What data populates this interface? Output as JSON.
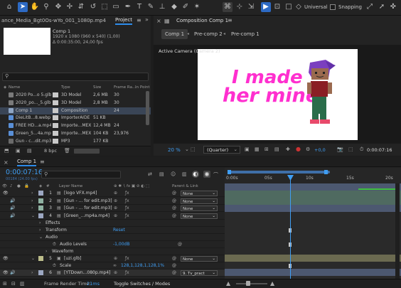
{
  "toolbar": {
    "home_icon": "home-icon",
    "universal_label": "Universal",
    "snapping_label": "Snapping"
  },
  "project": {
    "breadcrumb": "ance_Media_Bgt0Os-wYo_001_1080p.mp4",
    "tab_label": "Project",
    "selected_name": "Comp 1",
    "meta_line1": "1920 x 1080 (960 x 540) (1,00)",
    "meta_line2": "Δ 0:00:35:00, 24,00 fps",
    "search_placeholder": "",
    "columns": {
      "name": "Name",
      "type": "Type",
      "size": "Size",
      "frame_rate": "Frame Ra...",
      "in_point": "In Point"
    },
    "items": [
      {
        "name": "2020 Po...o 5.glb",
        "type": "3D Model",
        "size": "2,6 MB",
        "rate": "30",
        "icon_color": "#7a7a7a",
        "label_color": "#c9c9c9"
      },
      {
        "name": "2020_po..._5.glb",
        "type": "3D Model",
        "size": "2,8 MB",
        "rate": "30",
        "icon_color": "#7a7a7a",
        "label_color": "#c9c9c9"
      },
      {
        "name": "Comp 1",
        "type": "Composition",
        "size": "",
        "rate": "24",
        "icon_color": "#8fa6c4",
        "label_color": "#c9c9c9"
      },
      {
        "name": "DieLitB...8.webp",
        "type": "ImporterAIDE",
        "size": "51 KB",
        "rate": "",
        "icon_color": "#5a8fd6",
        "label_color": "#c9c9c9"
      },
      {
        "name": "FREE HD...a.mp4",
        "type": "Importe...MEX",
        "size": "12,4 MB",
        "rate": "24",
        "icon_color": "#5a8fd6",
        "label_color": "#c9c9c9"
      },
      {
        "name": "Green_5...4a.mp4",
        "type": "Importe...MEX",
        "size": "104 KB",
        "rate": "23,976",
        "icon_color": "#5a8fd6",
        "label_color": "#c9c9c9"
      },
      {
        "name": "Gun - c...dit.mp3",
        "type": "MP3",
        "size": "177 KB",
        "rate": "",
        "icon_color": "#6a6a6a",
        "label_color": "#c9c9c9"
      }
    ],
    "bpc_label": "8 bpc"
  },
  "composition": {
    "panel_title": "Composition Comp 1",
    "tabs": [
      "Comp 1",
      "Pre-comp 2",
      "Pre-comp 1"
    ],
    "camera_label": "Active Camera (Camera 2)",
    "canvas_text_line1": "I made",
    "canvas_text_line2": "her mine",
    "zoom": "20 %",
    "resolution": "(Quarter)",
    "exposure": "+0,0",
    "timecode": "0:00:07:16"
  },
  "timeline": {
    "tab": "Comp 1",
    "timecode": "0:00:07:16",
    "frames_label": "00184 (24.00 fps)",
    "search_placeholder": "",
    "col_layer_name": "Layer Name",
    "col_parent": "Parent & Link",
    "layers": [
      {
        "num": "1",
        "name": "[logo VFX.mp4]",
        "parent": "None",
        "color": "#9ca7c2"
      },
      {
        "num": "2",
        "name": "[Gun - ... for edit.mp3]",
        "parent": "None",
        "color": "#8fb2a2"
      },
      {
        "num": "3",
        "name": "[Gun - ... for edit.mp3]",
        "parent": "None",
        "color": "#8fb2a2"
      },
      {
        "num": "4",
        "name": "[Green_...mp4a.mp4]",
        "parent": "None",
        "color": "#9ca7c2"
      }
    ],
    "props": {
      "effects": "Effects",
      "transform": "Transform",
      "reset": "Reset",
      "audio": "Audio",
      "audio_levels": "Audio Levels",
      "audio_levels_value": "-1,00dB",
      "waveform": "Waveform"
    },
    "layer5": {
      "num": "5",
      "name": "[uzi.glb]",
      "parent": "None",
      "color": "#bcbd8a"
    },
    "scale_label": "Scale",
    "scale_value": "128,1,128,1,128,1%",
    "layer6": {
      "num": "6",
      "name": "[YTDown...080p.mp4]",
      "parent": "9. Tv_pract",
      "color": "#9ca7c2"
    },
    "ruler_labels": [
      "0:00s",
      "05s",
      "10s",
      "15s",
      "20s"
    ],
    "footer_render_label": "Frame Render Time:",
    "footer_render_value": "21ms",
    "footer_toggle": "Toggle Switches / Modes"
  }
}
